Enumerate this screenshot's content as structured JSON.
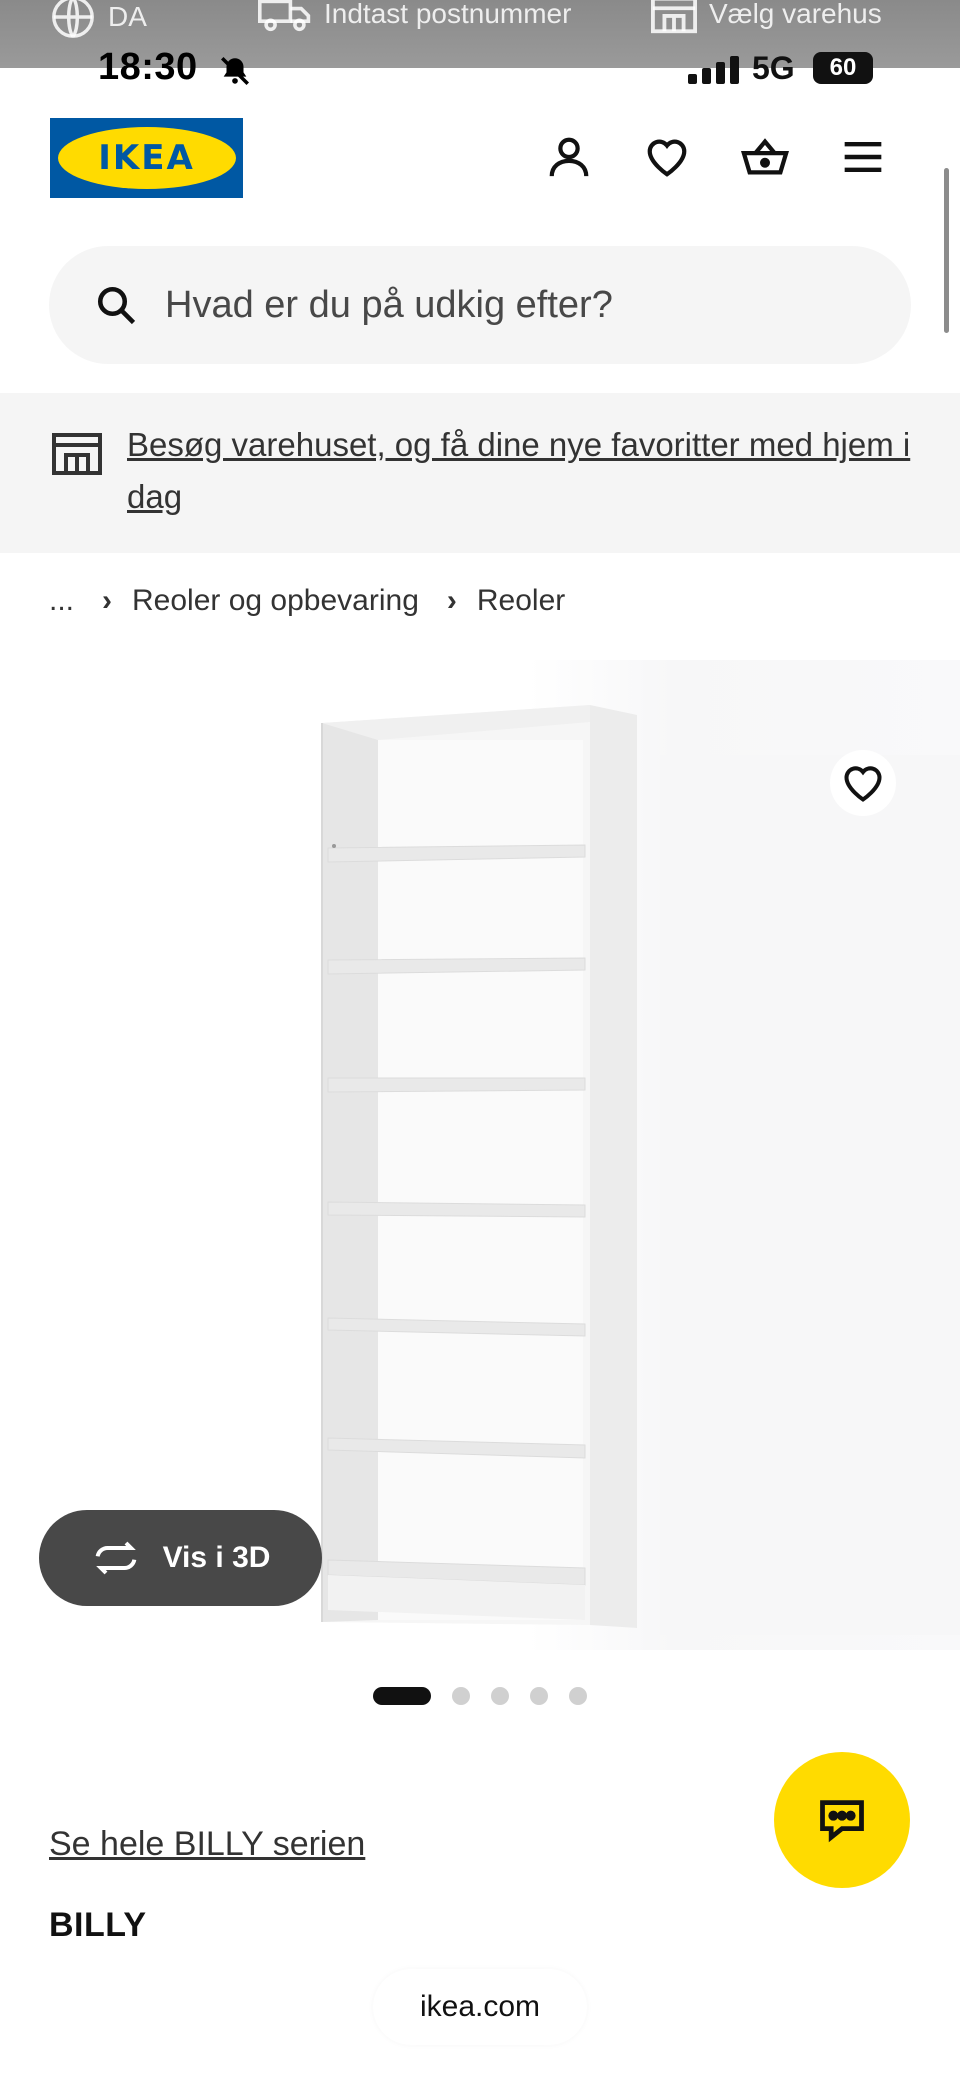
{
  "top_strip": {
    "language": "DA",
    "postcode": "Indtast postnummer",
    "store": "Vælg varehus"
  },
  "status_bar": {
    "time": "18:30",
    "network": "5G",
    "battery": "60"
  },
  "header": {
    "logo_text": "IKEA",
    "icons": [
      "user-icon",
      "heart-icon",
      "basket-icon",
      "menu-icon"
    ]
  },
  "search": {
    "placeholder": "Hvad er du på udkig efter?"
  },
  "banner": {
    "text": "Besøg varehuset, og få dine nye favoritter med hjem i dag"
  },
  "breadcrumb": {
    "ellipsis": "...",
    "items": [
      "Reoler og opbevaring",
      "Reoler"
    ]
  },
  "gallery": {
    "view_3d_label": "Vis i 3D",
    "image_count": 5,
    "active_index": 0
  },
  "product": {
    "series_link": "Se hele BILLY serien",
    "name": "BILLY"
  },
  "browser": {
    "url": "ikea.com"
  },
  "colors": {
    "brand_blue": "#0058a3",
    "brand_yellow": "#ffdb00",
    "button_dark": "#484848"
  }
}
